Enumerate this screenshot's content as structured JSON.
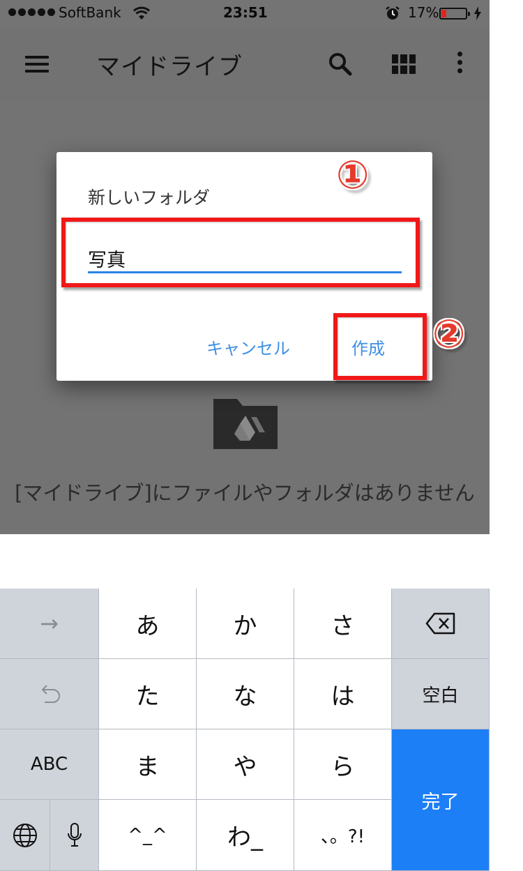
{
  "status_bar": {
    "carrier": "SoftBank",
    "time": "23:51",
    "battery": "17%"
  },
  "app_bar": {
    "title": "マイドライブ",
    "icons": [
      "menu-icon",
      "search-icon",
      "grid-view-icon",
      "more-vert-icon"
    ]
  },
  "content": {
    "empty_message": "[マイドライブ]にファイルやフォルダはありません"
  },
  "dialog": {
    "title": "新しいフォルダ",
    "input_value": "写真",
    "cancel_label": "キャンセル",
    "create_label": "作成"
  },
  "annotations": {
    "step1": "①",
    "step2": "②",
    "highlight_color": "#f01818"
  },
  "keyboard": {
    "arrow_key": "→",
    "row1": [
      "あ",
      "か",
      "さ"
    ],
    "row2": [
      "た",
      "な",
      "は"
    ],
    "row3": [
      "ま",
      "や",
      "ら"
    ],
    "row4": [
      "^_^",
      "わ_",
      "、。?!"
    ],
    "space_label": "空白",
    "abc_label": "ABC",
    "done_label": "完了",
    "icons": [
      "arrow-right-icon",
      "backspace-icon",
      "undo-icon",
      "globe-icon",
      "microphone-icon"
    ]
  },
  "colors": {
    "accent_blue": "#3f8fe3",
    "input_underline": "#2a83e6",
    "done_key": "#1d7ff6",
    "battery_low": "#e0261c"
  }
}
